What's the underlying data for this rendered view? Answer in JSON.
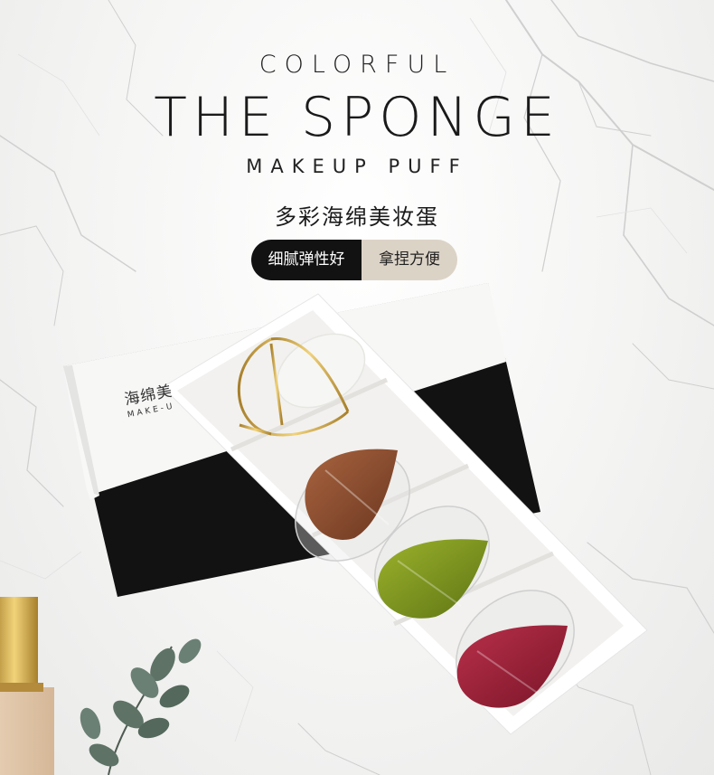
{
  "header": {
    "title_top": "COLORFUL",
    "title_main": "THE SPONGE",
    "title_sub": "MAKEUP PUFF",
    "title_cn": "多彩海绵美妆蛋"
  },
  "features": {
    "feature_1": "细腻弹性好",
    "feature_2": "拿捏方便"
  },
  "box": {
    "brand_cn": "海绵美",
    "brand_en": "MAKE-U"
  },
  "colors": {
    "pill_dark": "#121212",
    "pill_light": "#dcd3c7",
    "sponge_brown": "#8a4b2c",
    "sponge_green": "#7d9420",
    "sponge_red": "#9e1f36"
  }
}
